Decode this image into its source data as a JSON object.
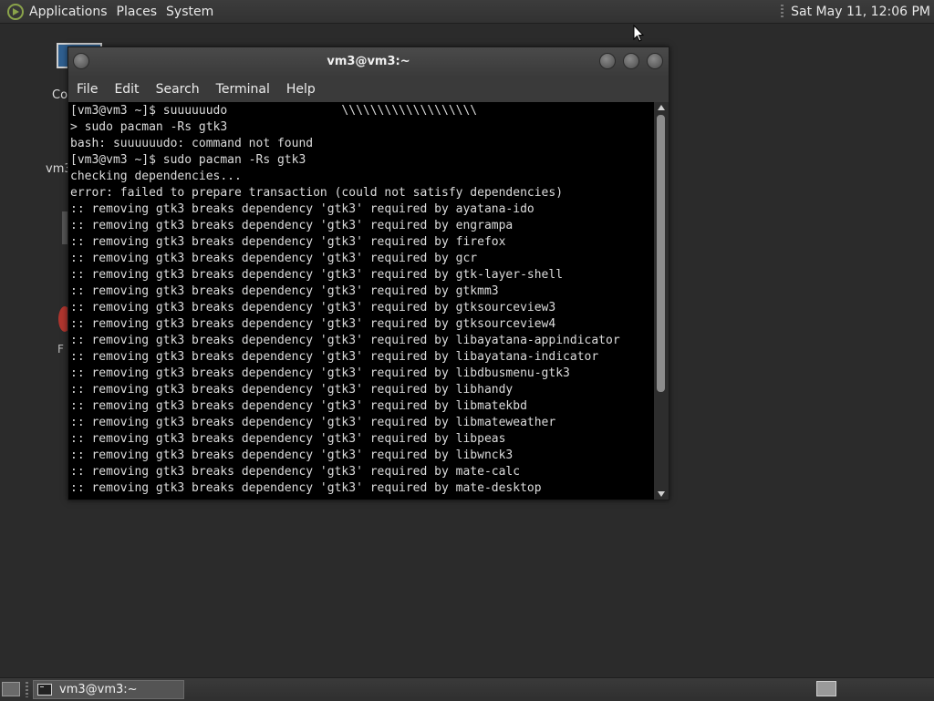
{
  "top_panel": {
    "menus": [
      "Applications",
      "Places",
      "System"
    ],
    "clock": "Sat May 11, 12:06 PM"
  },
  "desktop": {
    "icon_labels": [
      "Co",
      "vm3",
      "F"
    ]
  },
  "terminal": {
    "title": "vm3@vm3:~",
    "menu": [
      "File",
      "Edit",
      "Search",
      "Terminal",
      "Help"
    ],
    "lines": [
      "[vm3@vm3 ~]$ suuuuuudo                \\\\\\\\\\\\\\\\\\\\\\\\\\\\\\\\\\\\\\",
      "> sudo pacman -Rs gtk3",
      "bash: suuuuuudo: command not found",
      "[vm3@vm3 ~]$ sudo pacman -Rs gtk3",
      "checking dependencies...",
      "error: failed to prepare transaction (could not satisfy dependencies)",
      ":: removing gtk3 breaks dependency 'gtk3' required by ayatana-ido",
      ":: removing gtk3 breaks dependency 'gtk3' required by engrampa",
      ":: removing gtk3 breaks dependency 'gtk3' required by firefox",
      ":: removing gtk3 breaks dependency 'gtk3' required by gcr",
      ":: removing gtk3 breaks dependency 'gtk3' required by gtk-layer-shell",
      ":: removing gtk3 breaks dependency 'gtk3' required by gtkmm3",
      ":: removing gtk3 breaks dependency 'gtk3' required by gtksourceview3",
      ":: removing gtk3 breaks dependency 'gtk3' required by gtksourceview4",
      ":: removing gtk3 breaks dependency 'gtk3' required by libayatana-appindicator",
      ":: removing gtk3 breaks dependency 'gtk3' required by libayatana-indicator",
      ":: removing gtk3 breaks dependency 'gtk3' required by libdbusmenu-gtk3",
      ":: removing gtk3 breaks dependency 'gtk3' required by libhandy",
      ":: removing gtk3 breaks dependency 'gtk3' required by libmatekbd",
      ":: removing gtk3 breaks dependency 'gtk3' required by libmateweather",
      ":: removing gtk3 breaks dependency 'gtk3' required by libpeas",
      ":: removing gtk3 breaks dependency 'gtk3' required by libwnck3",
      ":: removing gtk3 breaks dependency 'gtk3' required by mate-calc",
      ":: removing gtk3 breaks dependency 'gtk3' required by mate-desktop"
    ]
  },
  "bottom_panel": {
    "taskbar_item": "vm3@vm3:~"
  }
}
